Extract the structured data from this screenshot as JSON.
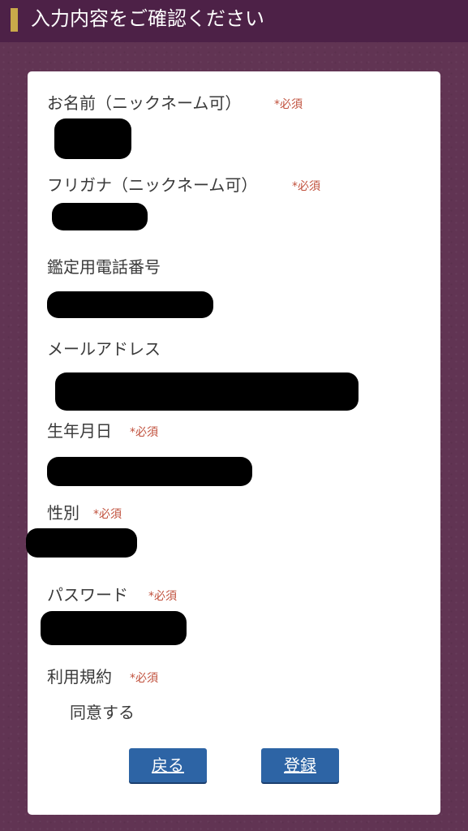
{
  "header": {
    "title": "入力内容をご確認ください",
    "accent_color": "#c9a94a"
  },
  "form": {
    "fields": [
      {
        "label": "お名前（ニックネーム可）",
        "required": "*必須"
      },
      {
        "label": "フリガナ（ニックネーム可）",
        "required": "*必須"
      },
      {
        "label": "鑑定用電話番号"
      },
      {
        "label": "メールアドレス"
      },
      {
        "label": "生年月日",
        "required": "*必須"
      },
      {
        "label": "性別",
        "required": "*必須"
      },
      {
        "label": "パスワード",
        "required": "*必須"
      },
      {
        "label": "利用規約",
        "required": "*必須",
        "value": "同意する"
      }
    ]
  },
  "buttons": {
    "back_label": "戻る",
    "register_label": "登録",
    "button_color": "#2d64a5"
  }
}
